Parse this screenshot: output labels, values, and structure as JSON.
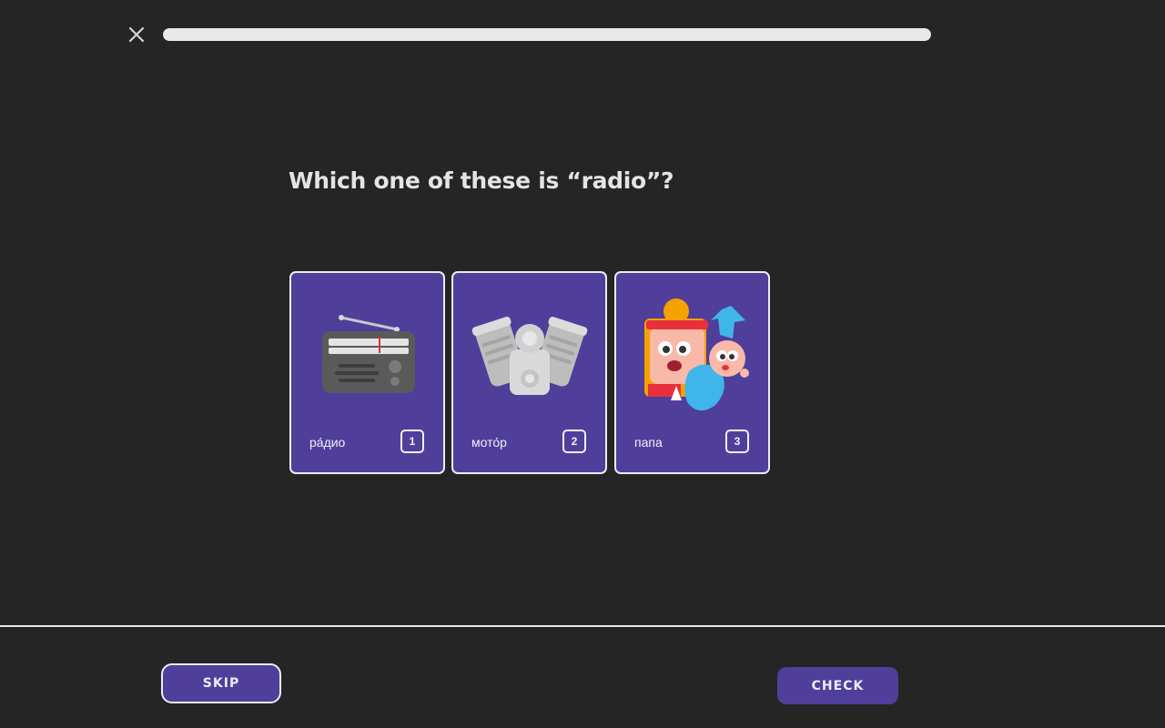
{
  "header": {
    "close_icon": "close-icon",
    "progress": 1.0
  },
  "question": {
    "text": "Which one of these is “radio”?"
  },
  "choices": [
    {
      "word": "ра́дио",
      "key": "1",
      "icon": "radio-icon"
    },
    {
      "word": "мото́р",
      "key": "2",
      "icon": "engine-icon"
    },
    {
      "word": "папа",
      "key": "3",
      "icon": "father-and-baby-icon"
    }
  ],
  "footer": {
    "skip_label": "SKIP",
    "check_label": "CHECK"
  },
  "colors": {
    "background": "#252525",
    "card": "#503e9b",
    "card_border": "#ececf4",
    "progress_fill": "#e8e8e8",
    "text": "#e4e4e4"
  }
}
